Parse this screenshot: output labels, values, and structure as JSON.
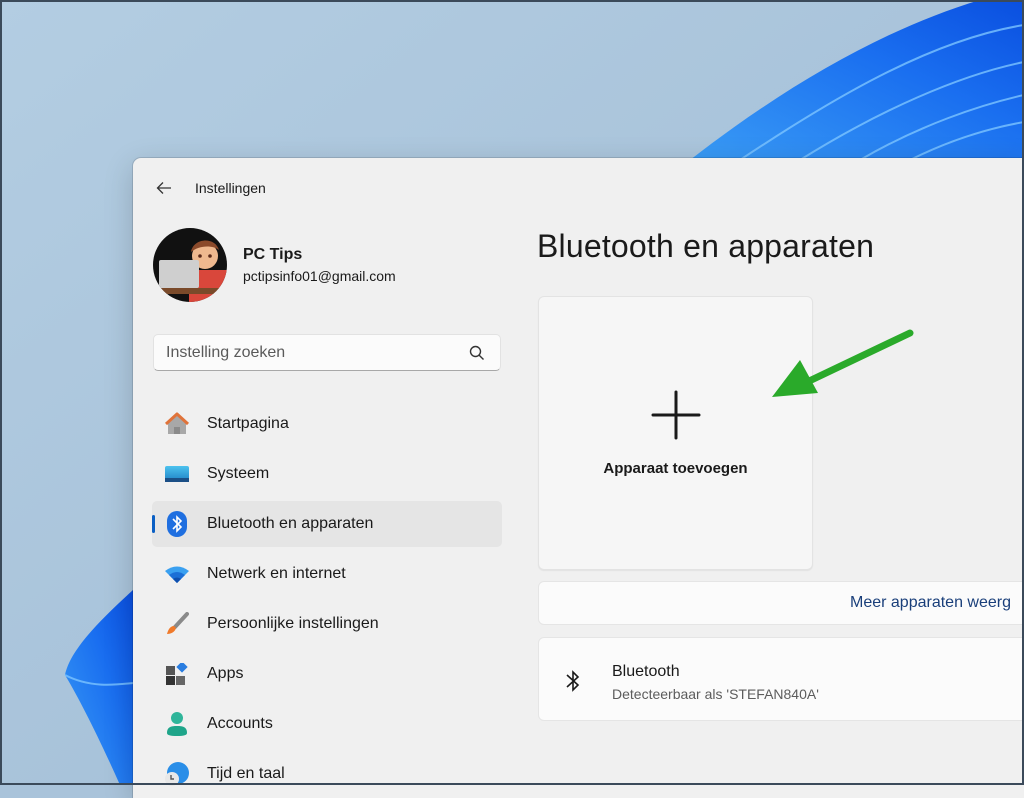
{
  "window": {
    "app_title": "Instellingen",
    "back_icon": "arrow-left-icon"
  },
  "profile": {
    "name": "PC Tips",
    "email": "pctipsinfo01@gmail.com"
  },
  "search": {
    "placeholder": "Instelling zoeken",
    "value": "",
    "icon": "search-icon"
  },
  "sidebar": {
    "items": [
      {
        "label": "Startpagina",
        "icon": "home-icon",
        "selected": false
      },
      {
        "label": "Systeem",
        "icon": "system-display-icon",
        "selected": false
      },
      {
        "label": "Bluetooth en apparaten",
        "icon": "bluetooth-icon",
        "selected": true
      },
      {
        "label": "Netwerk en internet",
        "icon": "wifi-icon",
        "selected": false
      },
      {
        "label": "Persoonlijke instellingen",
        "icon": "brush-icon",
        "selected": false
      },
      {
        "label": "Apps",
        "icon": "apps-icon",
        "selected": false
      },
      {
        "label": "Accounts",
        "icon": "person-icon",
        "selected": false
      },
      {
        "label": "Tijd en taal",
        "icon": "globe-clock-icon",
        "selected": false
      }
    ]
  },
  "main": {
    "title": "Bluetooth en apparaten",
    "add_device": {
      "label": "Apparaat toevoegen",
      "icon": "plus-icon"
    },
    "more_devices_link": "Meer apparaten weerg",
    "bluetooth": {
      "title": "Bluetooth",
      "subtitle": "Detecteerbaar als 'STEFAN840A'",
      "icon": "bluetooth-icon"
    }
  },
  "colors": {
    "accent": "#0a5fc4",
    "annotation_arrow": "#2aaa2a",
    "link": "#1a3f7a"
  }
}
